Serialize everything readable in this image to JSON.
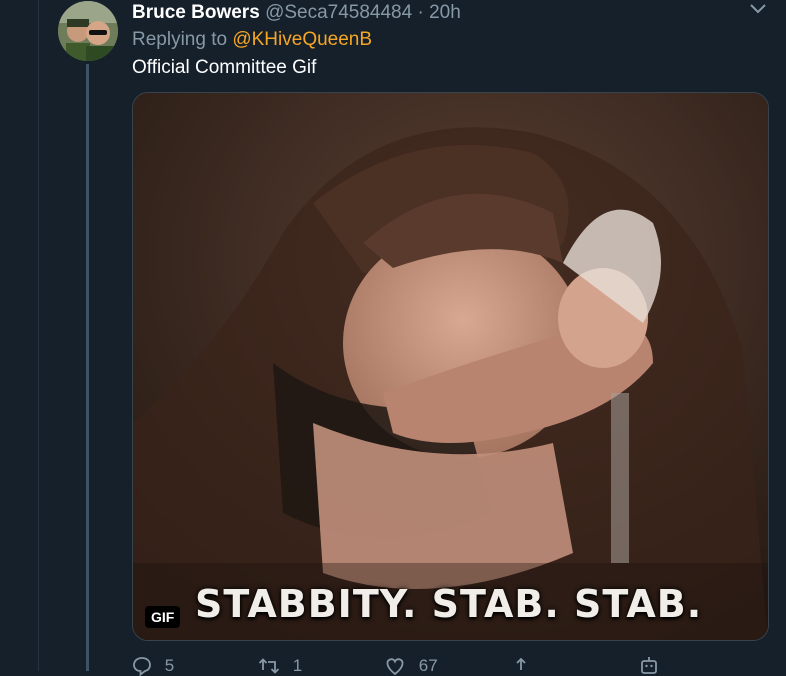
{
  "tweet": {
    "display_name": "Bruce Bowers",
    "handle": "@Seca74584484",
    "separator": "·",
    "time": "20h",
    "replying_prefix": "Replying to",
    "replying_to": "@KHiveQueenB",
    "text": "Official Committee Gif",
    "media": {
      "caption": "STABBITY. STAB. STAB.",
      "badge": "GIF"
    },
    "actions": {
      "reply_count": "5",
      "retweet_count": "1",
      "like_count": "67"
    }
  },
  "icons": {
    "more": "chevron-down-icon",
    "reply": "reply-icon",
    "retweet": "retweet-icon",
    "like": "heart-icon",
    "share": "share-icon",
    "analytics": "robot-icon"
  },
  "colors": {
    "background": "#15202b",
    "text_primary": "#ffffff",
    "text_secondary": "#8899a6",
    "accent_link": "#f5a623"
  }
}
